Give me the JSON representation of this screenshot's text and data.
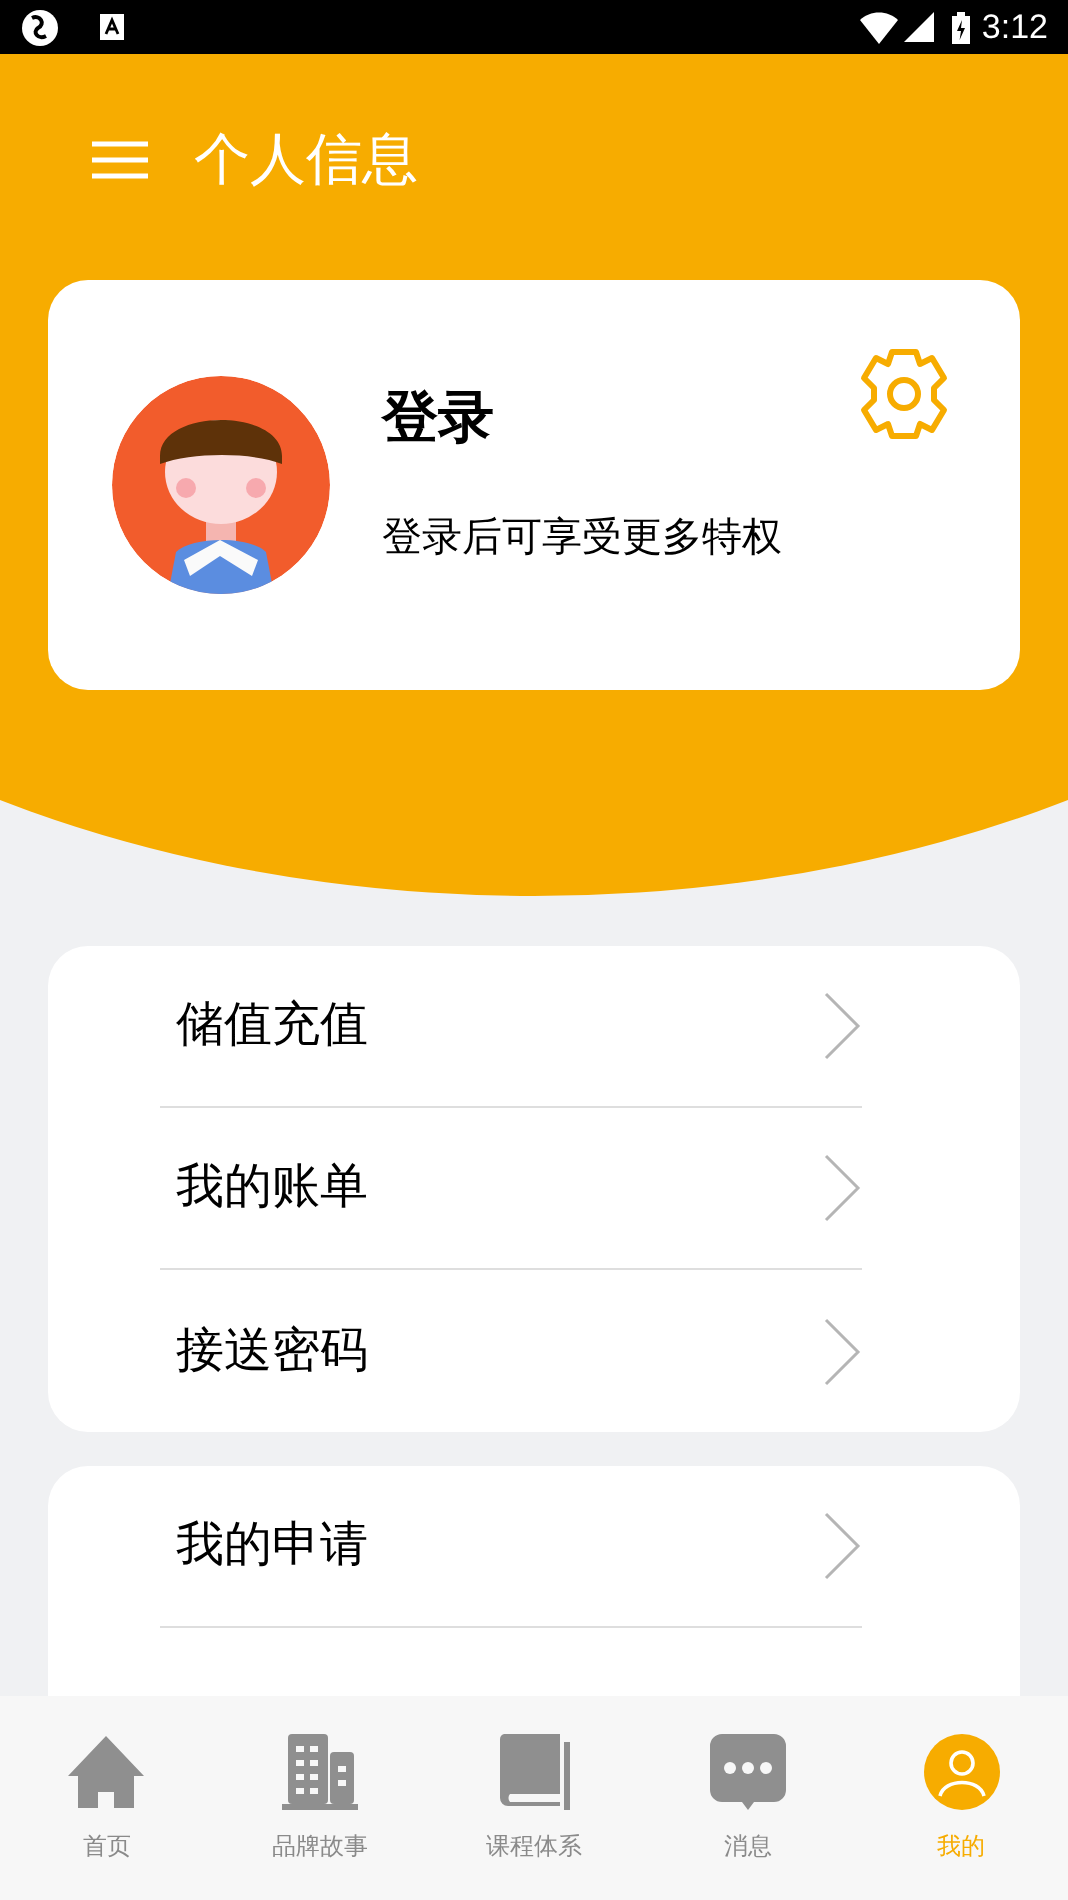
{
  "status_bar": {
    "time": "3:12"
  },
  "header": {
    "title": "个人信息"
  },
  "profile": {
    "name": "登录",
    "subtitle": "登录后可享受更多特权"
  },
  "menu_groups": [
    {
      "items": [
        {
          "label": "储值充值"
        },
        {
          "label": "我的账单"
        },
        {
          "label": "接送密码"
        }
      ]
    },
    {
      "items": [
        {
          "label": "我的申请"
        }
      ]
    }
  ],
  "tab_bar": [
    {
      "label": "首页",
      "kind": "home",
      "selected": false
    },
    {
      "label": "品牌故事",
      "kind": "buildings",
      "selected": false
    },
    {
      "label": "课程体系",
      "kind": "book",
      "selected": false
    },
    {
      "label": "消息",
      "kind": "chat",
      "selected": false
    },
    {
      "label": "我的",
      "kind": "person",
      "selected": true
    }
  ]
}
